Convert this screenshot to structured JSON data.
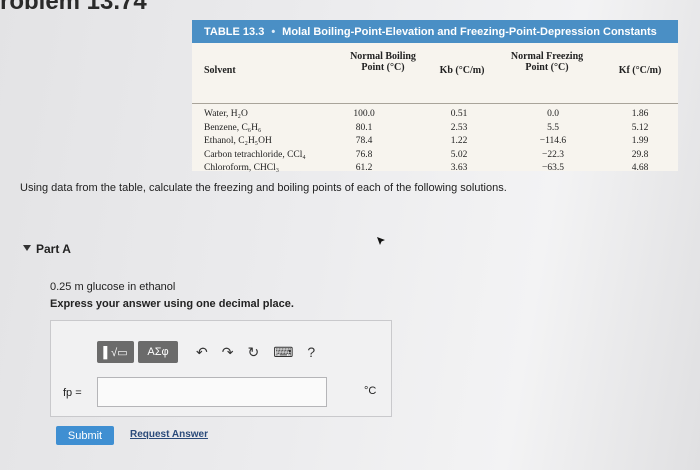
{
  "problem": {
    "title": "roblem 13.74"
  },
  "table": {
    "number": "TABLE 13.3",
    "separator": "•",
    "title": "Molal Boiling-Point-Elevation and Freezing-Point-Depression Constants",
    "headers": {
      "solvent": "Solvent",
      "normal_boiling_line1": "Normal Boiling",
      "normal_boiling_line2": "Point (°C)",
      "kb": "Kb (°C/m)",
      "normal_freezing_line1": "Normal Freezing",
      "normal_freezing_line2": "Point (°C)",
      "kf": "Kf (°C/m)"
    },
    "rows": [
      {
        "solvent": "Water, H₂O",
        "bp": "100.0",
        "kb": "0.51",
        "fp": "0.0",
        "kf": "1.86"
      },
      {
        "solvent": "Benzene, C₆H₆",
        "bp": "80.1",
        "kb": "2.53",
        "fp": "5.5",
        "kf": "5.12"
      },
      {
        "solvent": "Ethanol, C₂H₅OH",
        "bp": "78.4",
        "kb": "1.22",
        "fp": "−114.6",
        "kf": "1.99"
      },
      {
        "solvent": "Carbon tetrachloride, CCl₄",
        "bp": "76.8",
        "kb": "5.02",
        "fp": "−22.3",
        "kf": "29.8"
      },
      {
        "solvent": "Chloroform, CHCl₃",
        "bp": "61.2",
        "kb": "3.63",
        "fp": "−63.5",
        "kf": "4.68"
      }
    ]
  },
  "instruction": "Using data from the table, calculate the freezing and boiling points of each of the following solutions.",
  "part": {
    "label": "Part A",
    "prompt": "0.25 m glucose in ethanol",
    "bold_instruction": "Express your answer using one decimal place."
  },
  "answer": {
    "toolbar": {
      "template_label": "▌√▭",
      "symbols_label": "ΑΣφ",
      "icons": [
        "undo-icon",
        "redo-icon",
        "reset-icon",
        "keyboard-icon",
        "help-icon"
      ],
      "undo": "↶",
      "redo": "↷",
      "reset": "↻",
      "keyboard": "⌨",
      "help": "?"
    },
    "label": "fp =",
    "value": "",
    "unit": "°C"
  },
  "actions": {
    "submit": "Submit",
    "request_answer": "Request Answer"
  },
  "colors": {
    "table_header": "#4a8fc5",
    "submit_button": "#3f8fd2",
    "toolbar_button": "#6b6b6b"
  }
}
